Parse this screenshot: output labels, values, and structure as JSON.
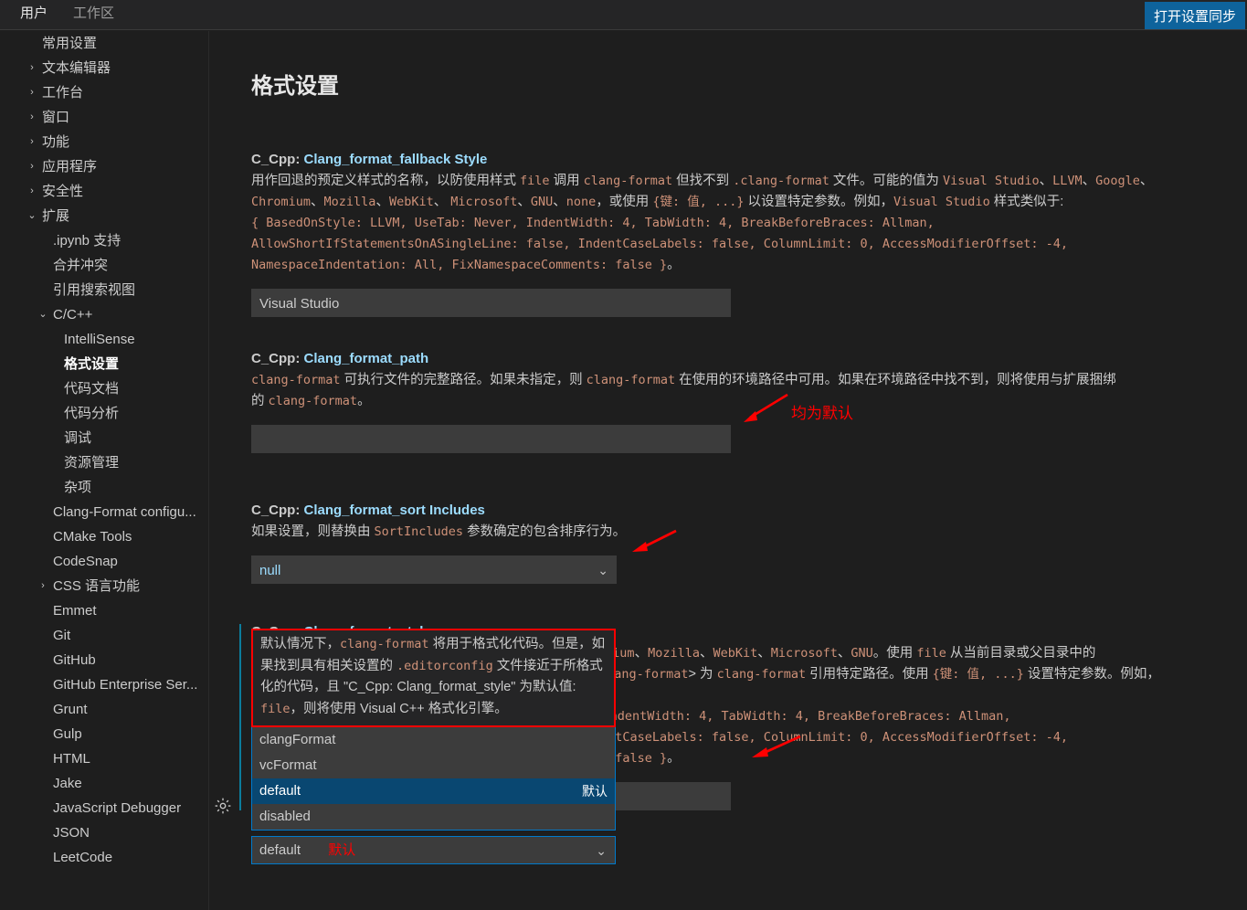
{
  "window": {
    "tabs": [
      {
        "label": "用户",
        "active": true
      },
      {
        "label": "工作区",
        "active": false
      }
    ],
    "sync_button": "打开设置同步"
  },
  "sidebar": {
    "items": [
      {
        "label": "常用设置",
        "level": 0,
        "twisty": "",
        "selected": false
      },
      {
        "label": "文本编辑器",
        "level": 0,
        "twisty": "›",
        "selected": false
      },
      {
        "label": "工作台",
        "level": 0,
        "twisty": "›",
        "selected": false
      },
      {
        "label": "窗口",
        "level": 0,
        "twisty": "›",
        "selected": false
      },
      {
        "label": "功能",
        "level": 0,
        "twisty": "›",
        "selected": false
      },
      {
        "label": "应用程序",
        "level": 0,
        "twisty": "›",
        "selected": false
      },
      {
        "label": "安全性",
        "level": 0,
        "twisty": "›",
        "selected": false
      },
      {
        "label": "扩展",
        "level": 0,
        "twisty": "⌄",
        "selected": false
      },
      {
        "label": ".ipynb 支持",
        "level": 1,
        "twisty": "",
        "selected": false
      },
      {
        "label": "合并冲突",
        "level": 1,
        "twisty": "",
        "selected": false
      },
      {
        "label": "引用搜索视图",
        "level": 1,
        "twisty": "",
        "selected": false
      },
      {
        "label": "C/C++",
        "level": 1,
        "twisty": "⌄",
        "selected": false
      },
      {
        "label": "IntelliSense",
        "level": 2,
        "twisty": "",
        "selected": false
      },
      {
        "label": "格式设置",
        "level": 2,
        "twisty": "",
        "selected": true
      },
      {
        "label": "代码文档",
        "level": 2,
        "twisty": "",
        "selected": false
      },
      {
        "label": "代码分析",
        "level": 2,
        "twisty": "",
        "selected": false
      },
      {
        "label": "调试",
        "level": 2,
        "twisty": "",
        "selected": false
      },
      {
        "label": "资源管理",
        "level": 2,
        "twisty": "",
        "selected": false
      },
      {
        "label": "杂项",
        "level": 2,
        "twisty": "",
        "selected": false
      },
      {
        "label": "Clang-Format configu...",
        "level": 1,
        "twisty": "",
        "selected": false
      },
      {
        "label": "CMake Tools",
        "level": 1,
        "twisty": "",
        "selected": false
      },
      {
        "label": "CodeSnap",
        "level": 1,
        "twisty": "",
        "selected": false
      },
      {
        "label": "CSS 语言功能",
        "level": 1,
        "twisty": "›",
        "selected": false
      },
      {
        "label": "Emmet",
        "level": 1,
        "twisty": "",
        "selected": false
      },
      {
        "label": "Git",
        "level": 1,
        "twisty": "",
        "selected": false
      },
      {
        "label": "GitHub",
        "level": 1,
        "twisty": "",
        "selected": false
      },
      {
        "label": "GitHub Enterprise Ser...",
        "level": 1,
        "twisty": "",
        "selected": false
      },
      {
        "label": "Grunt",
        "level": 1,
        "twisty": "",
        "selected": false
      },
      {
        "label": "Gulp",
        "level": 1,
        "twisty": "",
        "selected": false
      },
      {
        "label": "HTML",
        "level": 1,
        "twisty": "",
        "selected": false
      },
      {
        "label": "Jake",
        "level": 1,
        "twisty": "",
        "selected": false
      },
      {
        "label": "JavaScript Debugger",
        "level": 1,
        "twisty": "",
        "selected": false
      },
      {
        "label": "JSON",
        "level": 1,
        "twisty": "",
        "selected": false
      },
      {
        "label": "LeetCode",
        "level": 1,
        "twisty": "",
        "selected": false
      }
    ]
  },
  "main": {
    "page_title": "格式设置",
    "settings": {
      "fallback_style": {
        "category": "C_Cpp:",
        "name": "Clang_format_fallback Style",
        "desc_html": "用作回退的预定义样式的名称，以防使用样式 <code>file</code> 调用 <code>clang-format</code> 但找不到 <code>.clang-format</code> 文件。可能的值为 <code>Visual Studio</code>、<code>LLVM</code>、<code>Google</code>、<code>Chromium</code>、<code>Mozilla</code>、<code>WebKit</code>、 <code>Microsoft</code>、<code>GNU</code>、<code>none</code>，或使用 <code>{键: 值, ...}</code> 以设置特定参数。例如，<code>Visual Studio</code> 样式类似于:<br><code>{ BasedOnStyle: LLVM, UseTab: Never, IndentWidth: 4, TabWidth: 4, BreakBeforeBraces: Allman,</code><br><code>AllowShortIfStatementsOnASingleLine: false, IndentCaseLabels: false, ColumnLimit: 0, AccessModifierOffset: -4,</code><br><code>NamespaceIndentation: All, FixNamespaceComments: false }</code>。",
        "value": "Visual Studio"
      },
      "format_path": {
        "category": "C_Cpp:",
        "name": "Clang_format_path",
        "desc_html": "<code>clang-format</code> 可执行文件的完整路径。如果未指定，则 <code>clang-format</code> 在使用的环境路径中可用。如果在环境路径中找不到，则将使用与扩展捆绑<br>的 <code>clang-format</code>。",
        "value": ""
      },
      "sort_includes": {
        "category": "C_Cpp:",
        "name": "Clang_format_sort Includes",
        "desc_html": "如果设置，则替换由 <code>SortIncludes</code> 参数确定的包含排序行为。",
        "value": "null"
      },
      "format_style": {
        "category": "C_Cpp:",
        "name": "Clang_format_style",
        "desc_html": "编码样式目前支持: <code>Visual Studio</code>、<code>LLVM</code>、<code>Google</code>、<code>Chromium</code>、<code>Mozilla</code>、<code>WebKit</code>、<code>Microsoft</code>、<code>GNU</code>。使用 <code>file</code> 从当前目录或父目录中的<br><code>.clang-format</code> 文件加载样式，或使用 <code>file:</code>&lt;<code>path/to/.clang-format</code>&gt; 为 <code>clang-format</code> 引用特定路径。使用 <code>{键: 值, ...}</code> 设置特定参数。例如，<code>Visual Studio</code><br><code>样式类似于: { BasedOnStyle: LLVM, UseTab: Never, IndentWidth: 4, TabWidth: 4, BreakBeforeBraces: Allman,</code><br><code>AllowShortIfStatementsOnASingleLine: false, IndentCaseLabels: false, ColumnLimit: 0, AccessModifierOffset: -4,</code><br><code>NamespaceIndentation: All, FixNamespaceComments: false }</code>。",
        "value": ""
      }
    },
    "combobox": {
      "tooltip_html": "默认情况下，<code>clang-format</code> 将用于格式化代码。但是，如果找到具有相关设置的 <code>.editorconfig</code> 文件接近于所格式化的代码，且 \"C_Cpp: Clang_format_style\" 为默认值: <code>file</code>，则将使用 Visual C++ 格式化引擎。",
      "options": [
        {
          "label": "clangFormat",
          "desc": "",
          "selected": false
        },
        {
          "label": "vcFormat",
          "desc": "",
          "selected": false
        },
        {
          "label": "default",
          "desc": "默认",
          "selected": true
        },
        {
          "label": "disabled",
          "desc": "",
          "selected": false
        }
      ],
      "value": "default",
      "value_annotation": "默认"
    },
    "annotations": [
      {
        "text": "均为默认"
      }
    ],
    "icons": {
      "gear": "gear-icon",
      "chevron": "⌄"
    }
  },
  "colors": {
    "accent": "#007acc",
    "sync_button_bg": "#0e639c",
    "annotation_red": "#ff0000",
    "selected_option_bg": "#094771",
    "input_bg": "#3c3c3c",
    "background": "#1e1e1e",
    "setting_name": "#9cdcfe",
    "code_text": "#ce9178"
  }
}
